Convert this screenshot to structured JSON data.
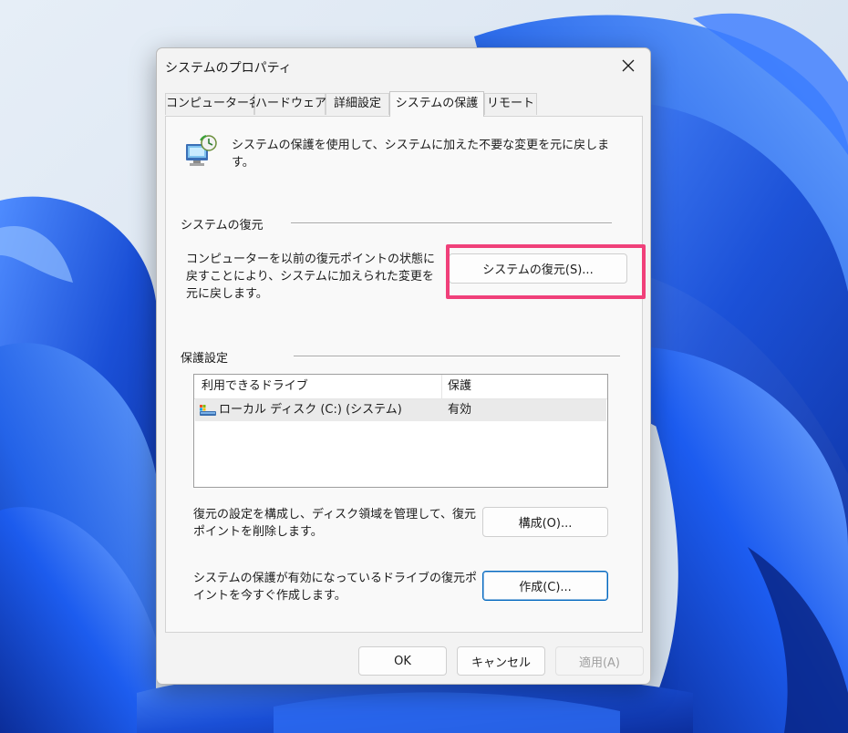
{
  "dialog": {
    "title": "システムのプロパティ",
    "tabs": [
      {
        "label": "コンピューター名"
      },
      {
        "label": "ハードウェア"
      },
      {
        "label": "詳細設定"
      },
      {
        "label": "システムの保護",
        "active": true
      },
      {
        "label": "リモート"
      }
    ],
    "intro_text": "システムの保護を使用して、システムに加えた不要な変更を元に戻します。",
    "restore_group": {
      "title": "システムの復元",
      "description": "コンピューターを以前の復元ポイントの状態に戻すことにより、システムに加えられた変更を元に戻します。",
      "button_label": "システムの復元(S)..."
    },
    "protection_group": {
      "title": "保護設定",
      "columns": [
        "利用できるドライブ",
        "保護"
      ],
      "drives": [
        {
          "name": "ローカル ディスク (C:) (システム)",
          "status": "有効",
          "icon": "drive-icon"
        }
      ],
      "configure_text": "復元の設定を構成し、ディスク領域を管理して、復元ポイントを削除します。",
      "configure_button": "構成(O)...",
      "create_text": "システムの保護が有効になっているドライブの復元ポイントを今すぐ作成します。",
      "create_button": "作成(C)..."
    },
    "footer": {
      "ok": "OK",
      "cancel": "キャンセル",
      "apply": "適用(A)"
    }
  },
  "colors": {
    "highlight": "#f0407a",
    "accent": "#0067c0",
    "wallpaper_blue": "#1f5fe0"
  }
}
